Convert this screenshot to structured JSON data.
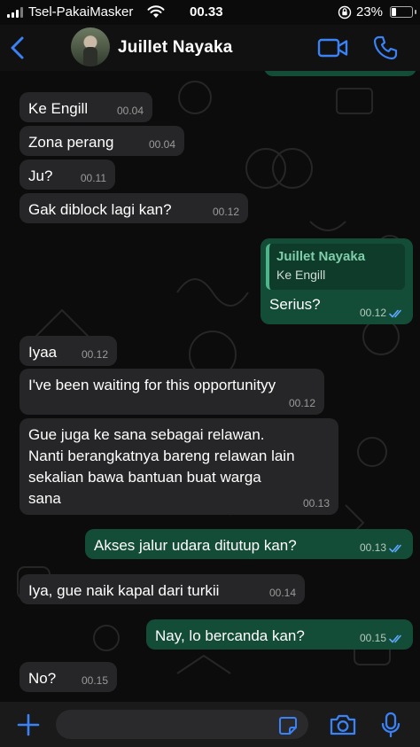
{
  "status_bar": {
    "carrier": "Tsel-PakaiMasker",
    "time": "00.33",
    "battery": "23%",
    "battery_level": 0.23,
    "icons": [
      "signal-icon",
      "wifi-icon",
      "rotation-lock-icon",
      "battery-icon"
    ]
  },
  "header": {
    "contact_name": "Juillet Nayaka",
    "icons": [
      "back-chevron-icon",
      "avatar",
      "video-camera-icon",
      "phone-icon"
    ]
  },
  "messages": [
    {
      "dir": "in",
      "text": "Ke Engill",
      "time": "00.04"
    },
    {
      "dir": "in",
      "text": "Zona perang",
      "time": "00.04"
    },
    {
      "dir": "in",
      "text": "Ju?",
      "time": "00.11"
    },
    {
      "dir": "in",
      "text": "Gak diblock lagi kan?",
      "time": "00.12"
    },
    {
      "dir": "out",
      "text": "Serius?",
      "time": "00.12",
      "status": "read",
      "reply_to": {
        "name": "Juillet Nayaka",
        "text": "Ke Engill"
      }
    },
    {
      "dir": "in",
      "text": "Iyaa",
      "time": "00.12"
    },
    {
      "dir": "in",
      "text": "I've been waiting for this opportunityy",
      "time": "00.12"
    },
    {
      "dir": "in",
      "text": "Gue juga ke sana sebagai relawan.\nNanti berangkatnya bareng relawan lain\nsekalian bawa bantuan buat warga\nsana",
      "time": "00.13"
    },
    {
      "dir": "out",
      "text": "Akses jalur udara ditutup kan?",
      "time": "00.13",
      "status": "read"
    },
    {
      "dir": "in",
      "text": "Iya, gue naik kapal dari turkii",
      "time": "00.14"
    },
    {
      "dir": "out",
      "text": "Nay, lo bercanda kan?",
      "time": "00.15",
      "status": "read"
    },
    {
      "dir": "in",
      "text": "No?",
      "time": "00.15"
    }
  ],
  "composer": {
    "placeholder": "",
    "value": "",
    "icons": [
      "plus-icon",
      "sticker-icon",
      "camera-icon",
      "microphone-icon"
    ]
  },
  "colors": {
    "incoming_bubble": "#262628",
    "outgoing_bubble": "#134d37",
    "accent": "#3b82f6",
    "read_ticks": "#5ea8ff"
  }
}
